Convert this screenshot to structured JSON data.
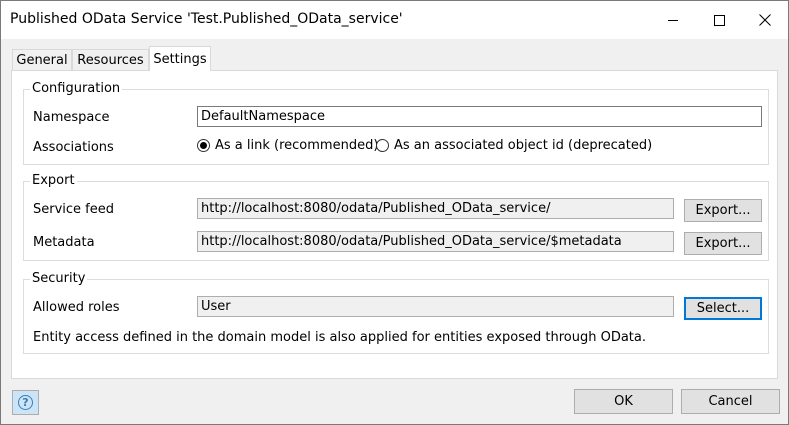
{
  "window": {
    "title": "Published OData Service 'Test.Published_OData_service'"
  },
  "tabs": [
    {
      "label": "General"
    },
    {
      "label": "Resources"
    },
    {
      "label": "Settings",
      "active": true
    }
  ],
  "configuration": {
    "group_label": "Configuration",
    "namespace_label": "Namespace",
    "namespace_value": "DefaultNamespace",
    "associations_label": "Associations",
    "association_options": [
      {
        "label": "As a link (recommended)",
        "selected": true
      },
      {
        "label": "As an associated object id (deprecated)",
        "selected": false
      }
    ]
  },
  "export": {
    "group_label": "Export",
    "service_feed_label": "Service feed",
    "service_feed_value": "http://localhost:8080/odata/Published_OData_service/",
    "service_feed_button": "Export...",
    "metadata_label": "Metadata",
    "metadata_value": "http://localhost:8080/odata/Published_OData_service/$metadata",
    "metadata_button": "Export..."
  },
  "security": {
    "group_label": "Security",
    "allowed_roles_label": "Allowed roles",
    "allowed_roles_value": "User",
    "select_button": "Select...",
    "note": "Entity access defined in the domain model is also applied for entities exposed through OData."
  },
  "footer": {
    "ok_label": "OK",
    "cancel_label": "Cancel",
    "help_icon": "help-icon"
  },
  "colors": {
    "focus_accent": "#0078d7",
    "help_background": "#cce4f7"
  }
}
